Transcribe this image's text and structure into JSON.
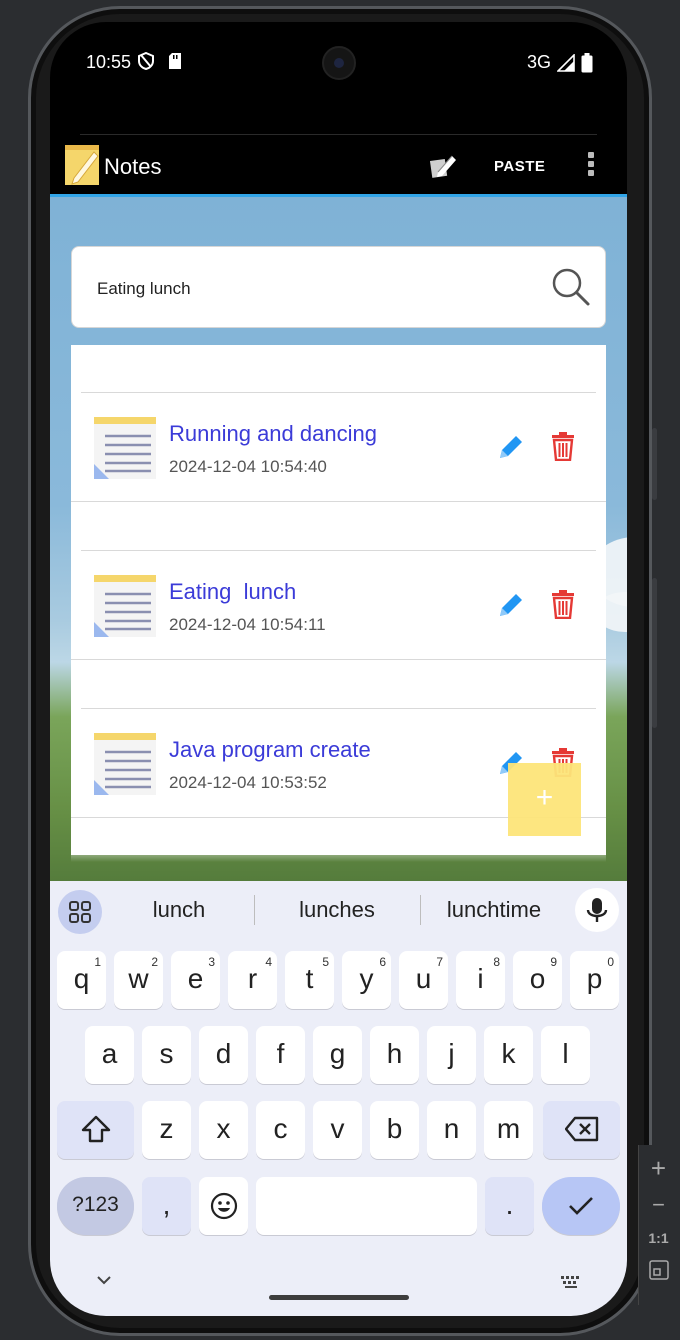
{
  "status_bar": {
    "time": "10:55",
    "network": "3G"
  },
  "app_bar": {
    "title": "Notes",
    "paste_label": "PASTE"
  },
  "search": {
    "value": "Eating lunch"
  },
  "notes": [
    {
      "title": "Running and dancing",
      "date": "2024-12-04 10:54:40"
    },
    {
      "title": "Eating  lunch",
      "date": "2024-12-04 10:54:11"
    },
    {
      "title": "Java program create",
      "date": "2024-12-04 10:53:52"
    }
  ],
  "fab": {
    "label": "+"
  },
  "keyboard": {
    "suggestions": [
      "lunch",
      "lunches",
      "lunchtime"
    ],
    "row1": [
      {
        "k": "q",
        "n": "1"
      },
      {
        "k": "w",
        "n": "2"
      },
      {
        "k": "e",
        "n": "3"
      },
      {
        "k": "r",
        "n": "4"
      },
      {
        "k": "t",
        "n": "5"
      },
      {
        "k": "y",
        "n": "6"
      },
      {
        "k": "u",
        "n": "7"
      },
      {
        "k": "i",
        "n": "8"
      },
      {
        "k": "o",
        "n": "9"
      },
      {
        "k": "p",
        "n": "0"
      }
    ],
    "row2": [
      "a",
      "s",
      "d",
      "f",
      "g",
      "h",
      "j",
      "k",
      "l"
    ],
    "row3": [
      "z",
      "x",
      "c",
      "v",
      "b",
      "n",
      "m"
    ],
    "num_label": "?123",
    "comma": ",",
    "period": "."
  },
  "emulator_panel": {
    "zoom_in": "+",
    "zoom_out": "−",
    "ratio": "1:1"
  },
  "colors": {
    "accent": "#31a5e8",
    "note_title": "#3b3bd8",
    "delete": "#e53935",
    "edit": "#2196f3",
    "fab": "#fde57a"
  }
}
